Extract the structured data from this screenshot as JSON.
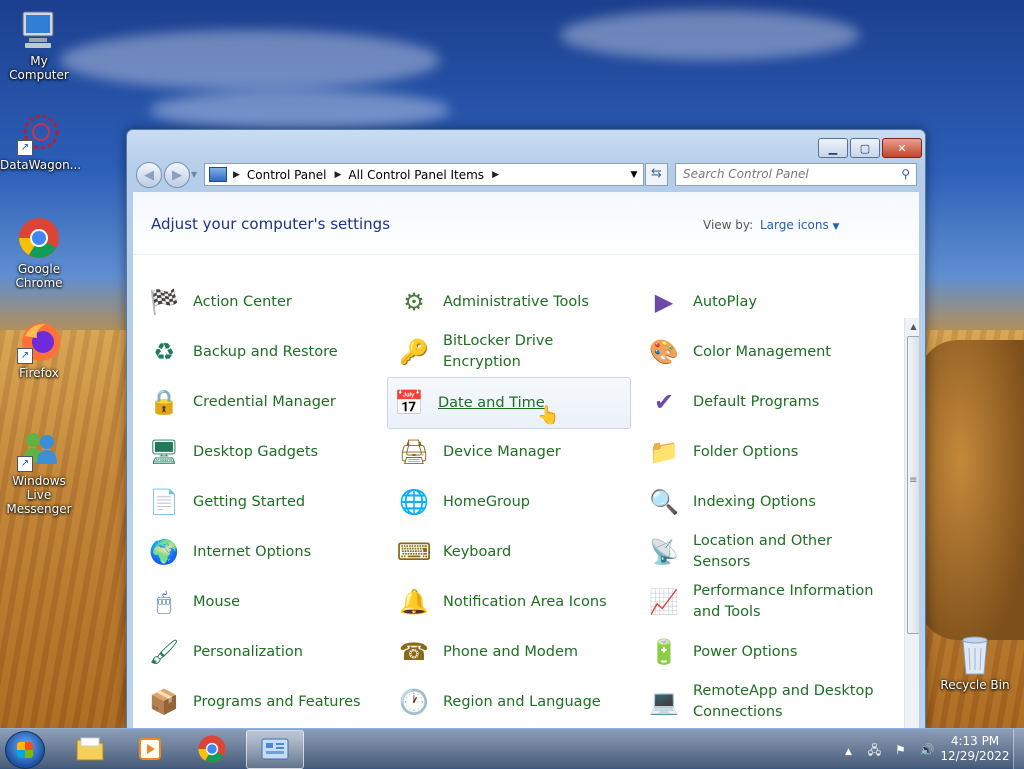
{
  "desktop": {
    "icons": [
      {
        "label": "My Computer",
        "icon": "computer-icon"
      },
      {
        "label": "DataWagon...",
        "icon": "datawagon-icon"
      },
      {
        "label": "Google Chrome",
        "icon": "chrome-icon"
      },
      {
        "label": "Firefox",
        "icon": "firefox-icon"
      },
      {
        "label": "Windows Live Messenger",
        "icon": "messenger-icon"
      },
      {
        "label": "Recycle Bin",
        "icon": "recycle-bin-icon"
      }
    ]
  },
  "window": {
    "breadcrumb": [
      "Control Panel",
      "All Control Panel Items"
    ],
    "search_placeholder": "Search Control Panel",
    "title": "Adjust your computer's settings",
    "view_by_label": "View by:",
    "view_mode": "Large icons",
    "items": [
      {
        "label": "Action Center",
        "icon": "flag-icon"
      },
      {
        "label": "Administrative Tools",
        "icon": "admin-tools-icon"
      },
      {
        "label": "AutoPlay",
        "icon": "autoplay-icon"
      },
      {
        "label": "Backup and Restore",
        "icon": "backup-icon"
      },
      {
        "label": "BitLocker Drive Encryption",
        "icon": "bitlocker-icon"
      },
      {
        "label": "Color Management",
        "icon": "color-management-icon"
      },
      {
        "label": "Credential Manager",
        "icon": "vault-icon"
      },
      {
        "label": "Date and Time",
        "icon": "calendar-clock-icon"
      },
      {
        "label": "Default Programs",
        "icon": "default-programs-icon"
      },
      {
        "label": "Desktop Gadgets",
        "icon": "gadgets-icon"
      },
      {
        "label": "Device Manager",
        "icon": "device-manager-icon"
      },
      {
        "label": "Folder Options",
        "icon": "folder-icon"
      },
      {
        "label": "Getting Started",
        "icon": "getting-started-icon"
      },
      {
        "label": "HomeGroup",
        "icon": "homegroup-icon"
      },
      {
        "label": "Indexing Options",
        "icon": "indexing-icon"
      },
      {
        "label": "Internet Options",
        "icon": "globe-icon"
      },
      {
        "label": "Keyboard",
        "icon": "keyboard-icon"
      },
      {
        "label": "Location and Other Sensors",
        "icon": "sensors-icon"
      },
      {
        "label": "Mouse",
        "icon": "mouse-icon"
      },
      {
        "label": "Notification Area Icons",
        "icon": "notification-icon"
      },
      {
        "label": "Performance Information and Tools",
        "icon": "performance-icon"
      },
      {
        "label": "Personalization",
        "icon": "personalization-icon"
      },
      {
        "label": "Phone and Modem",
        "icon": "phone-icon"
      },
      {
        "label": "Power Options",
        "icon": "power-icon"
      },
      {
        "label": "Programs and Features",
        "icon": "programs-icon"
      },
      {
        "label": "Region and Language",
        "icon": "region-icon"
      },
      {
        "label": "RemoteApp and Desktop Connections",
        "icon": "remoteapp-icon"
      }
    ]
  },
  "taskbar": {
    "time": "4:13 PM",
    "date": "12/29/2022"
  },
  "colors": {
    "link_green": "#1d6f22",
    "title_blue": "#1e3287",
    "accent_blue": "#1f5fb8"
  }
}
